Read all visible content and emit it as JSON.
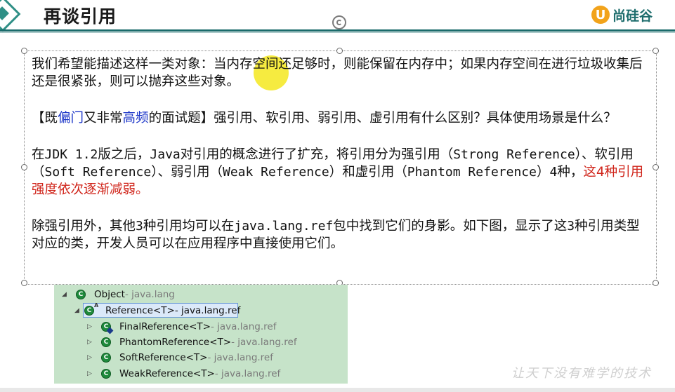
{
  "header": {
    "title": "再谈引用",
    "brand_letter": "U",
    "brand_name": "尚硅谷"
  },
  "content": {
    "p1": "我们希望能描述这样一类对象：当内存空间还足够时，则能保留在内存中；如果内存空间在进行垃圾收集后还是很紧张，则可以抛弃这些对象。",
    "p2_a": "【既",
    "p2_b": "偏门",
    "p2_c": "又非常",
    "p2_d": "高频",
    "p2_e": "的面试题】强引用、软引用、弱引用、虚引用有什么区别？具体使用场景是什么？",
    "p3_a": "在",
    "p3_b": "JDK 1.2",
    "p3_c": "版之后，",
    "p3_d": "Java",
    "p3_e": "对引用的概念进行了扩充，将引用分为强引用（",
    "p3_f": "Strong Reference",
    "p3_g": "）、软引用（",
    "p3_h": "Soft Reference",
    "p3_i": "）、弱引用（",
    "p3_j": "Weak Reference",
    "p3_k": "）和虚引用（",
    "p3_l": "Phantom Reference",
    "p3_m": "）",
    "p3_n": "4",
    "p3_o": "种，",
    "p3_red": "这4种引用强度依次逐渐减弱。",
    "p4_a": "除强引用外，其他",
    "p4_b": "3",
    "p4_c": "种引用均可以在",
    "p4_d": "java.lang.ref",
    "p4_e": "包中找到它们的身影。如下图，显示了这",
    "p4_f": "3",
    "p4_g": "种引用类型对应的类，开发人员可以在应用程序中直接使用它们。"
  },
  "tree": {
    "rows": [
      {
        "name": "Object",
        "pkg": " - java.lang",
        "icon_letter": "C"
      },
      {
        "name": "Reference<T>",
        "pkg": " - java.lang.ref",
        "icon_letter": "C",
        "abstract": "A"
      },
      {
        "name": "FinalReference<T>",
        "pkg": " - java.lang.ref",
        "icon_letter": "C"
      },
      {
        "name": "PhantomReference<T>",
        "pkg": " - java.lang.ref",
        "icon_letter": "C"
      },
      {
        "name": "SoftReference<T>",
        "pkg": " - java.lang.ref",
        "icon_letter": "C"
      },
      {
        "name": "WeakReference<T>",
        "pkg": " - java.lang.ref",
        "icon_letter": "C"
      }
    ],
    "expanded_glyph": "◢",
    "collapsed_glyph": "▷"
  },
  "watermark": "让天下没有难学的技术",
  "colors": {
    "header_line": "#1a6b6b",
    "brand_orange": "#f2a31b",
    "highlight_blue": "#1a34c8",
    "highlight_red": "#d0241a",
    "tree_bg": "#c6e3c9"
  }
}
